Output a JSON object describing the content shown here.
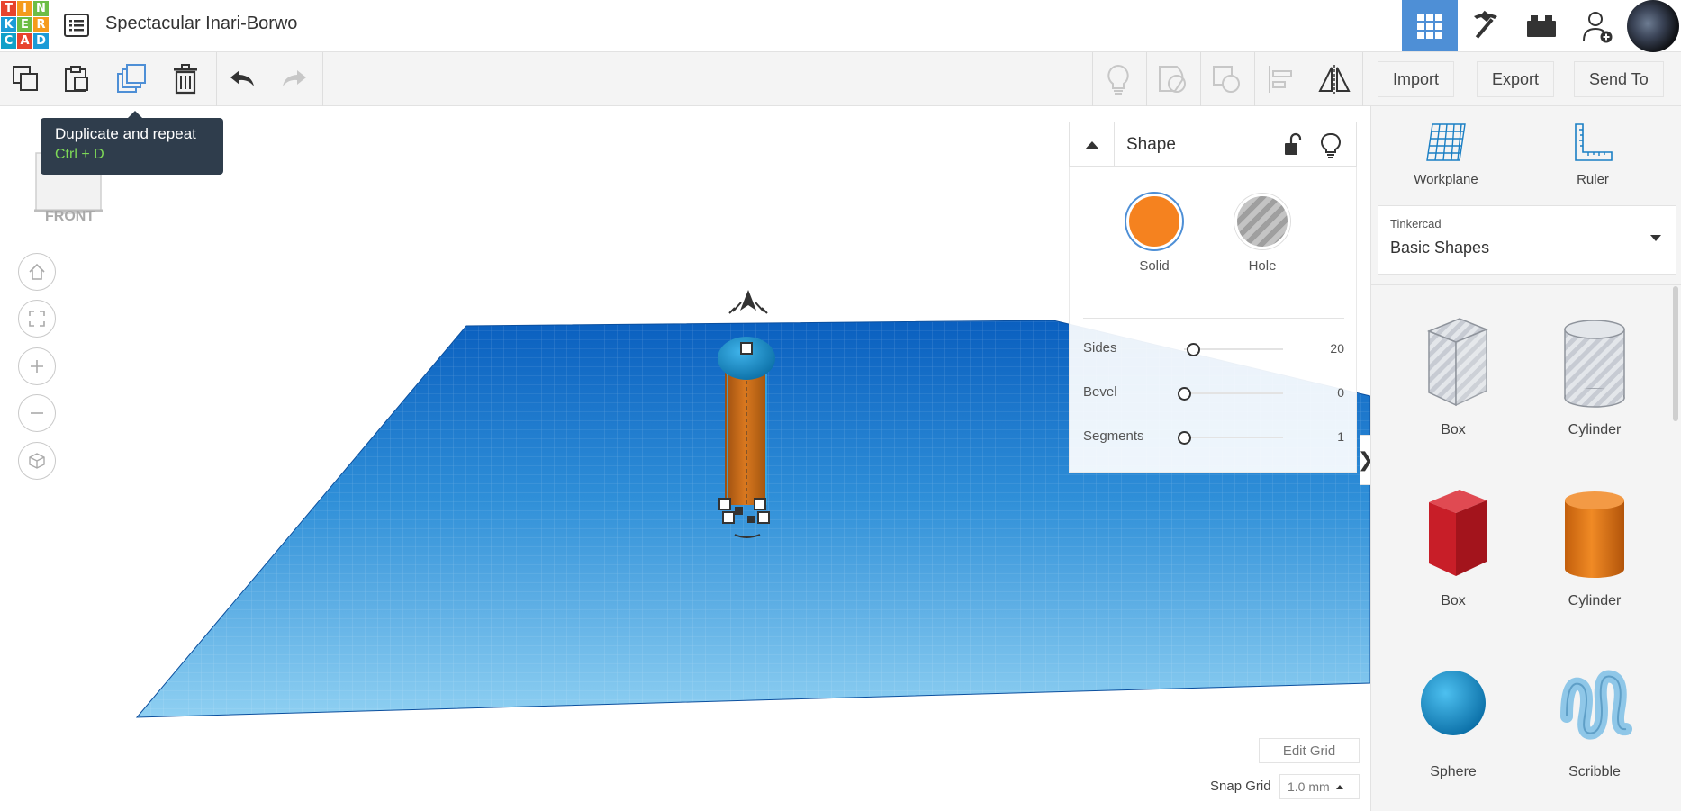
{
  "app": {
    "logo_letters": [
      "T",
      "I",
      "N",
      "K",
      "E",
      "R",
      "C",
      "A",
      "D"
    ],
    "document_title": "Spectacular Inari-Borwo"
  },
  "top_right": {
    "grid_view": "grid-view-icon",
    "build_view": "pickaxe-icon",
    "bricks_view": "brick-icon",
    "user_add": "add-user-icon",
    "accent": "#4e8fd6"
  },
  "toolbar": {
    "copy": "copy-icon",
    "paste": "paste-icon",
    "duplicate": "duplicate-icon",
    "delete": "trash-icon",
    "undo": "undo-icon",
    "redo": "redo-icon",
    "import_label": "Import",
    "export_label": "Export",
    "send_to_label": "Send To"
  },
  "tooltip": {
    "title": "Duplicate and repeat",
    "shortcut": "Ctrl + D"
  },
  "viewcube": {
    "face_label": "FRONT"
  },
  "shape_panel": {
    "title": "Shape",
    "materials": [
      {
        "label": "Solid",
        "color": "#f5821f"
      },
      {
        "label": "Hole",
        "color": "#b8b8b8"
      }
    ],
    "properties": [
      {
        "label": "Sides",
        "value": "20",
        "fraction": 0.1
      },
      {
        "label": "Bevel",
        "value": "0",
        "fraction": 0
      },
      {
        "label": "Segments",
        "value": "1",
        "fraction": 0
      }
    ]
  },
  "grid_controls": {
    "edit_grid_label": "Edit Grid",
    "snap_grid_label": "Snap Grid",
    "snap_grid_value": "1.0 mm"
  },
  "right_panel": {
    "tools": [
      {
        "label": "Workplane",
        "icon": "workplane-icon"
      },
      {
        "label": "Ruler",
        "icon": "ruler-icon"
      }
    ],
    "library": {
      "provider": "Tinkercad",
      "category": "Basic Shapes"
    },
    "shapes": [
      {
        "label": "Box",
        "kind": "box-hole"
      },
      {
        "label": "Cylinder",
        "kind": "cylinder-hole"
      },
      {
        "label": "Box",
        "kind": "box-solid",
        "color": "#d21f2b"
      },
      {
        "label": "Cylinder",
        "kind": "cylinder-solid",
        "color": "#e8761a"
      },
      {
        "label": "Sphere",
        "kind": "sphere",
        "color": "#1a93c9"
      },
      {
        "label": "Scribble",
        "kind": "scribble",
        "color": "#8fc7e8"
      }
    ]
  }
}
